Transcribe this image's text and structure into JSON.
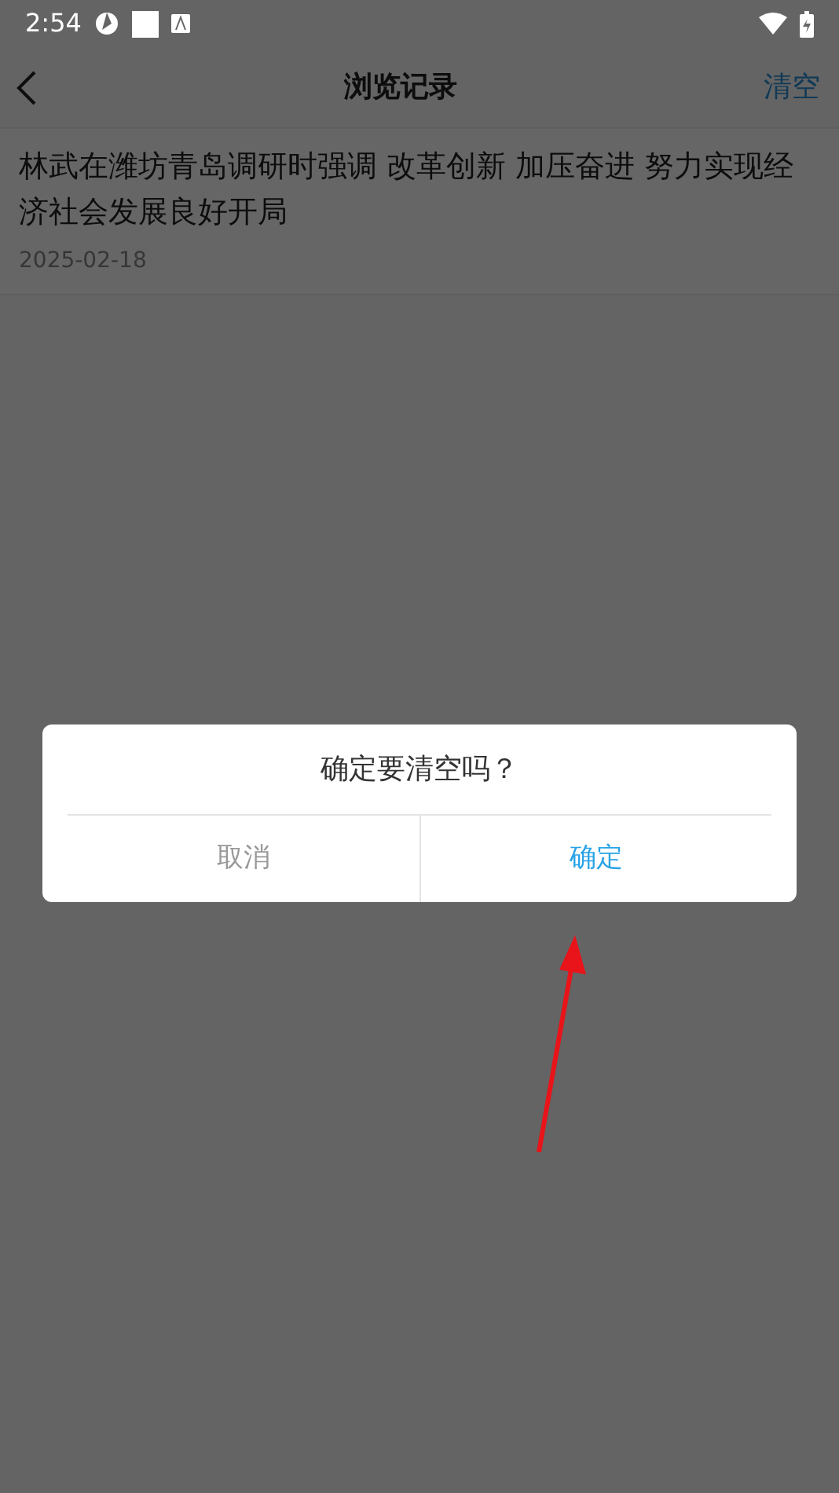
{
  "status_bar": {
    "time": "2:54"
  },
  "header": {
    "title": "浏览记录",
    "action": "清空"
  },
  "history": [
    {
      "title": "林武在潍坊青岛调研时强调 改革创新 加压奋进 努力实现经济社会发展良好开局",
      "date": "2025-02-18"
    }
  ],
  "dialog": {
    "message": "确定要清空吗？",
    "buttons": [
      {
        "label": "取消",
        "kind": "cancel"
      },
      {
        "label": "确定",
        "kind": "confirm"
      }
    ]
  },
  "annotation": {
    "kind": "arrow",
    "color": "#e8141a"
  }
}
